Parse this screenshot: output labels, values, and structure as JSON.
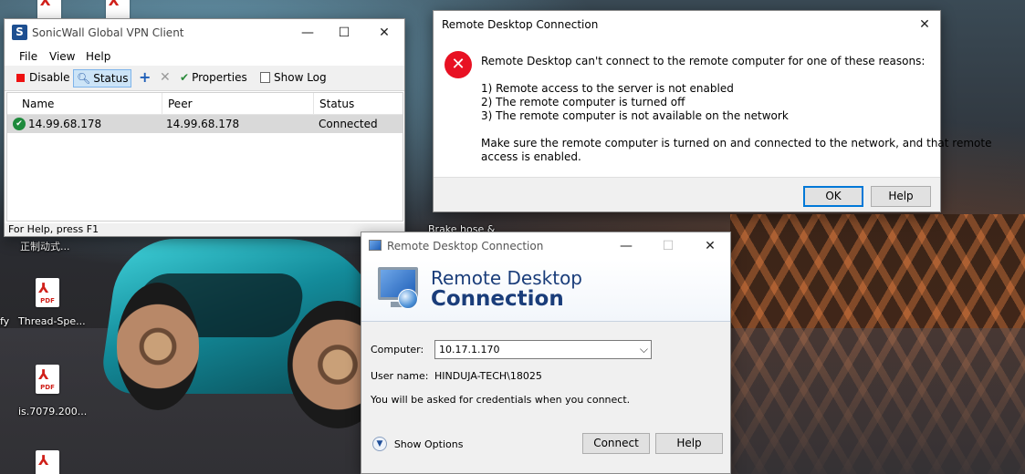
{
  "desktop": {
    "icons": [
      {
        "label": "",
        "type": "pdf"
      },
      {
        "label": "",
        "type": "pdf"
      },
      {
        "label": "正制动式...",
        "type": "pdf"
      },
      {
        "label": "Thread-Spe...",
        "type": "pdf"
      },
      {
        "label": "is.7079.200...",
        "type": "pdf"
      },
      {
        "label": "",
        "type": "pdf"
      }
    ],
    "edge_label_1": "fy",
    "wallpaper_label": "Brake hose &"
  },
  "vpn": {
    "title": "SonicWall Global VPN Client",
    "menu": [
      "File",
      "View",
      "Help"
    ],
    "toolbar": {
      "disable": "Disable",
      "status": "Status",
      "properties": "Properties",
      "show_log": "Show Log"
    },
    "columns": [
      "Name",
      "Peer",
      "Status"
    ],
    "rows": [
      {
        "name": "14.99.68.178",
        "peer": "14.99.68.178",
        "status": "Connected"
      }
    ],
    "statusbar": "For Help, press F1"
  },
  "error_dialog": {
    "title": "Remote Desktop Connection",
    "message": "Remote Desktop can't connect to the remote computer for one of these reasons:",
    "reasons": [
      "1) Remote access to the server is not enabled",
      "2) The remote computer is turned off",
      "3) The remote computer is not available on the network"
    ],
    "advice_line1": "Make sure the remote computer is turned on and connected to the network, and that remote",
    "advice_line2": "access is enabled.",
    "ok": "OK",
    "help": "Help"
  },
  "rdc": {
    "title": "Remote Desktop Connection",
    "banner_line1": "Remote Desktop",
    "banner_line2": "Connection",
    "computer_label": "Computer:",
    "computer_value": "10.17.1.170",
    "username_label": "User name:",
    "username_value": "HINDUJA-TECH\\18025",
    "credentials_note": "You will be asked for credentials when you connect.",
    "show_options": "Show Options",
    "connect": "Connect",
    "help": "Help"
  },
  "colors": {
    "error_red": "#e81123",
    "accent_blue": "#0078d7",
    "banner_text": "#1a3d7a",
    "connected_green": "#1e8a3c"
  }
}
